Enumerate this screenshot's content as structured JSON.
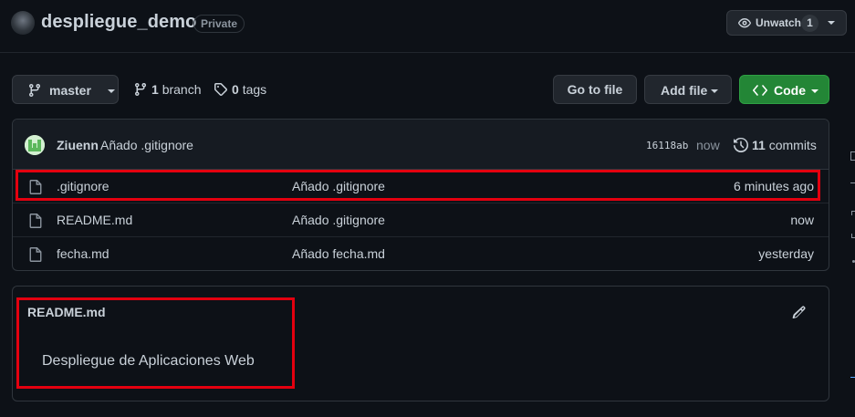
{
  "header": {
    "repo_name": "despliegue_demo",
    "visibility": "Private",
    "watch_label": "Unwatch",
    "watch_count": "1"
  },
  "toolbar": {
    "branch_label": "master",
    "branches_count": "1",
    "branches_label": "branch",
    "tags_count": "0",
    "tags_label": "tags",
    "goto_label": "Go to file",
    "addfile_label": "Add file",
    "code_label": "Code"
  },
  "commit": {
    "author": "Ziuenn",
    "message": "Añado .gitignore",
    "sha": "16118ab",
    "when": "now",
    "count": "11",
    "count_label": "commits"
  },
  "files": [
    {
      "name": ".gitignore",
      "message": "Añado .gitignore",
      "age": "6 minutes ago"
    },
    {
      "name": "README.md",
      "message": "Añado .gitignore",
      "age": "now"
    },
    {
      "name": "fecha.md",
      "message": "Añado fecha.md",
      "age": "yesterday"
    }
  ],
  "readme": {
    "title": "README.md",
    "body": "Despliegue de Aplicaciones Web"
  },
  "colors": {
    "background": "#0d1117",
    "primary_button": "#238636",
    "highlight": "#e3000f"
  }
}
